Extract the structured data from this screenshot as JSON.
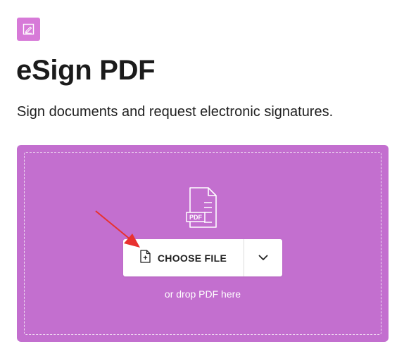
{
  "tool": {
    "icon": "pen-edit-icon",
    "title": "eSign PDF",
    "subtitle": "Sign documents and request electronic signatures."
  },
  "dropzone": {
    "file_icon": "pdf-file-icon",
    "file_icon_text": "PDF",
    "choose_button_icon": "file-add-icon",
    "choose_button_label": "CHOOSE FILE",
    "dropdown_icon": "chevron-down-icon",
    "drop_hint": "or drop PDF here"
  },
  "colors": {
    "accent": "#d77ad8",
    "dropzone": "#c36fcf",
    "annotation_arrow": "#e8312f"
  }
}
